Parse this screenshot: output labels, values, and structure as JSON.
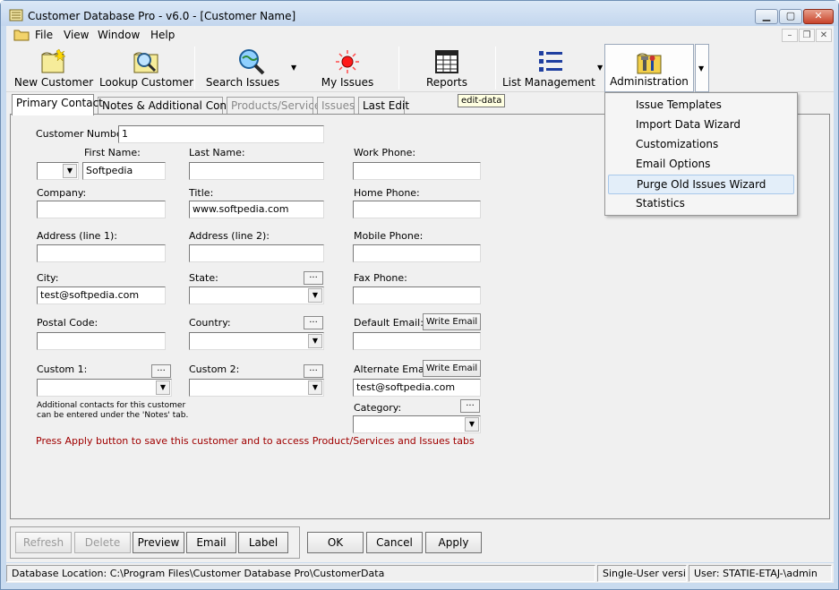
{
  "window": {
    "title": "Customer Database Pro - v6.0 - [Customer Name]",
    "min": "▁",
    "max": "▢",
    "close": "✕"
  },
  "menu": {
    "file": "File",
    "view": "View",
    "window": "Window",
    "help": "Help",
    "mdi_min": "–",
    "mdi_restore": "❐",
    "mdi_close": "✕"
  },
  "toolbar": {
    "new_customer": "New Customer",
    "lookup_customer": "Lookup Customer",
    "search_issues": "Search Issues",
    "my_issues": "My Issues",
    "reports": "Reports",
    "list_management": "List Management",
    "administration": "Administration",
    "drop_arrow": "▼"
  },
  "tooltip": "edit-data",
  "admin_menu": {
    "items": [
      "Issue Templates",
      "Import Data Wizard",
      "Customizations",
      "Email Options",
      "Purge Old Issues Wizard",
      "Statistics"
    ],
    "hover_index": 4
  },
  "tabs": {
    "primary": "Primary Contact",
    "notes": "Notes & Additional Contacts",
    "products": "Products/Services",
    "issues": "Issues",
    "last_edit": "Last Edit"
  },
  "form": {
    "customer_number_label": "Customer Number:",
    "customer_number": "1",
    "first_name_label": "First Name:",
    "first_name": "Softpedia",
    "last_name_label": "Last Name:",
    "last_name": "",
    "work_phone_label": "Work Phone:",
    "company_label": "Company:",
    "title_label": "Title:",
    "title": "www.softpedia.com",
    "home_phone_label": "Home Phone:",
    "address1_label": "Address (line 1):",
    "address2_label": "Address (line 2):",
    "mobile_phone_label": "Mobile Phone:",
    "city_label": "City:",
    "city": "test@softpedia.com",
    "state_label": "State:",
    "fax_phone_label": "Fax Phone:",
    "postal_code_label": "Postal Code:",
    "country_label": "Country:",
    "default_email_label": "Default Email:",
    "write_email": "Write Email",
    "custom1_label": "Custom 1:",
    "custom2_label": "Custom 2:",
    "alternate_email_label": "Alternate Email:",
    "alternate_email": "test@softpedia.com",
    "category_label": "Category:",
    "dots": "...",
    "combo_arrow": "▼",
    "note_line1": "Additional contacts for this customer",
    "note_line2": "can be entered under the 'Notes' tab.",
    "warning": "Press Apply button to save this customer and to access Product/Services and Issues tabs"
  },
  "buttons": {
    "refresh": "Refresh",
    "delete": "Delete",
    "preview": "Preview",
    "email": "Email",
    "label": "Label",
    "ok": "OK",
    "cancel": "Cancel",
    "apply": "Apply"
  },
  "status": {
    "db_location": "Database Location: C:\\Program Files\\Customer Database Pro\\CustomerData",
    "mode": "Single-User version",
    "user": "User: STATIE-ETAJ-\\admin"
  }
}
